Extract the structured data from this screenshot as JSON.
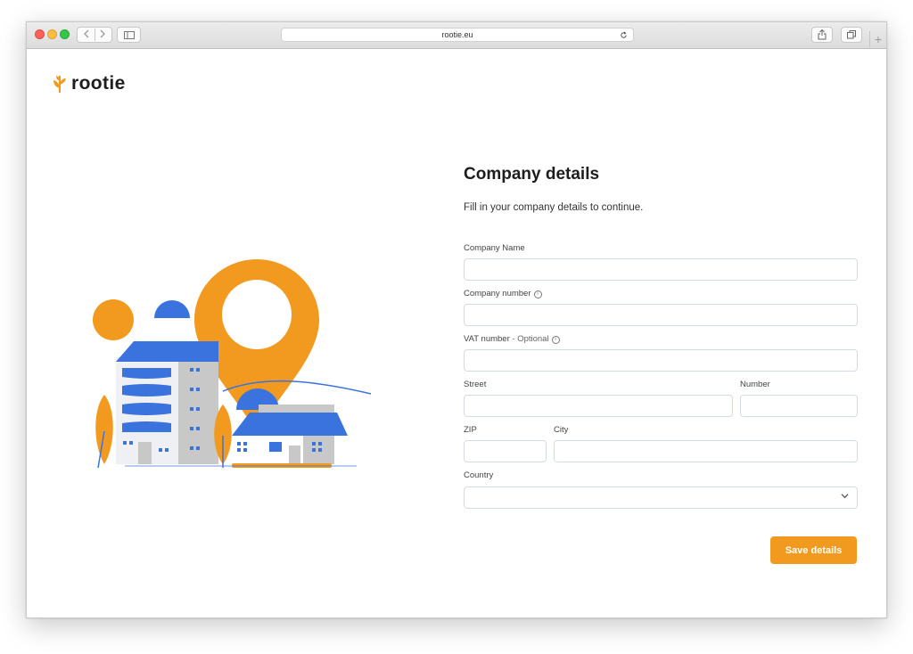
{
  "browser": {
    "url": "rootie.eu",
    "reload_icon": "reload-icon",
    "share_icon": "share-icon",
    "tabs_icon": "tabs-icon",
    "plus_label": "+"
  },
  "brand": {
    "name": "rootie",
    "icon": "wheat-icon",
    "accent": "#f29a1f",
    "blue": "#3b73de"
  },
  "form": {
    "title": "Company details",
    "subtitle": "Fill in your company details to continue.",
    "fields": {
      "company_name": {
        "label": "Company Name",
        "value": ""
      },
      "company_number": {
        "label": "Company number",
        "info_icon": "i",
        "value": ""
      },
      "vat_number": {
        "label": "VAT number",
        "optional": " - Optional",
        "info_icon": "i",
        "value": ""
      },
      "street": {
        "label": "Street",
        "value": ""
      },
      "number": {
        "label": "Number",
        "value": ""
      },
      "zip": {
        "label": "ZIP",
        "value": ""
      },
      "city": {
        "label": "City",
        "value": ""
      },
      "country": {
        "label": "Country",
        "value": ""
      }
    },
    "save_label": "Save details"
  }
}
